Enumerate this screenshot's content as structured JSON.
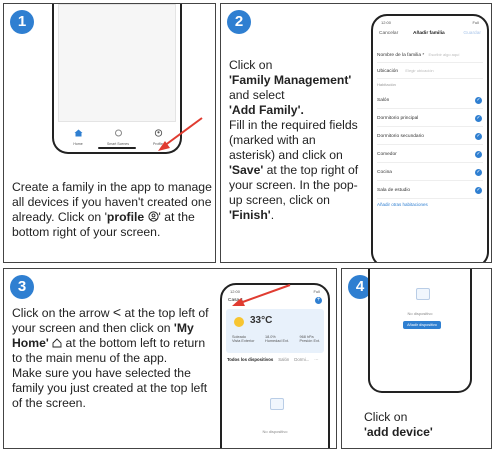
{
  "steps": [
    {
      "number": "1"
    },
    {
      "number": "2"
    },
    {
      "number": "3"
    },
    {
      "number": "4"
    }
  ],
  "step1": {
    "text_a": "Create a family in the app to manage all devices if you haven't created one already. Click on '",
    "bold_a": "profile",
    "text_b": "' at the bottom right of your screen.",
    "tabs": [
      "Home",
      "Smart Scenes",
      "Profile"
    ]
  },
  "step2": {
    "l1": "Click on",
    "l2": "'Family Management'",
    "l3": "and select",
    "l4": "'Add Family'.",
    "l5": "Fill in the required fields (marked with an asterisk) and click on",
    "l6": "'Save'",
    "l7": " at the top right of your screen. In the pop-up screen, click on ",
    "l8": "'Finish'",
    "l9": ".",
    "phone": {
      "status_time": "12:00",
      "status_right": "Full",
      "cancel": "Cancelar",
      "title": "Añadir familia",
      "save": "Guardar",
      "name_label": "Nombre de la familia *",
      "name_placeholder": "Escribir algo aquí",
      "location_label": "Ubicación",
      "location_placeholder": "Elegir ubicación",
      "rooms_header": "Habitación",
      "rooms": [
        "Salón",
        "Dormitorio principal",
        "Dormitorio secundario",
        "Comedor",
        "Cocina",
        "Sala de estudio"
      ],
      "add_rooms": "Añadir otras habitaciones"
    }
  },
  "step3": {
    "text_a": "Click on the arrow ",
    "arrow": "<",
    "text_b": " at the top left of your screen and then click on ",
    "bold_home": "'My Home'",
    "text_c": " at the bottom left to return to the main menu of the app.",
    "text_d": "Make sure you have selected the family you just created at the top left of the screen.",
    "phone": {
      "status_time": "12:00",
      "status_right": "Full",
      "family": "Casa 1",
      "temp": "33°C",
      "weather": [
        "Soleado",
        "18.0%",
        "968 hPa"
      ],
      "weather_sub": [
        "Vista Exterior",
        "Humedad Ext.",
        "Presión Ext."
      ],
      "tabs": [
        "Todos los dispositivos",
        "Salón",
        "Dormi...",
        "···"
      ],
      "empty": "No dispositivo"
    }
  },
  "step4": {
    "l1": "Click on",
    "l2": "'add device'",
    "phone": {
      "empty": "No dispositivo",
      "button": "Añadir dispositivo"
    }
  },
  "colors": {
    "accent": "#2f7fd1",
    "arrow": "#e03c31"
  }
}
